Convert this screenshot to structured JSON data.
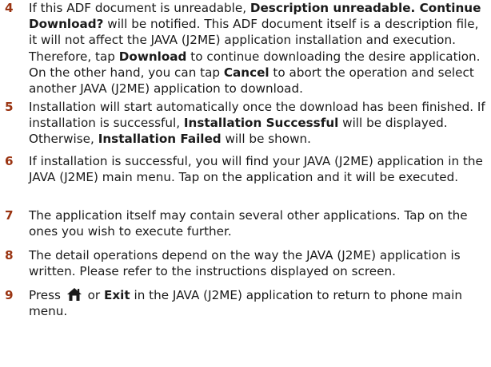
{
  "steps": [
    {
      "number": "4",
      "p1": "If this ADF document is unreadable, ",
      "b1": "Description unreadable. Continue Download?",
      "p2": " will be notified. This ADF document itself is a description file, it will not affect the JAVA (J2ME) application installation and execution. Therefore, tap ",
      "b2": "Download",
      "p3": " to continue downloading the desire application. On the other hand, you can tap ",
      "b3": "Cancel",
      "p4": " to abort the operation and select another JAVA (J2ME) application to download."
    },
    {
      "number": "5",
      "p1": "Installation will start automatically once the download has been finished. If installation is successful, ",
      "b1": "Installation Successful",
      "p2": " will be displayed. Otherwise, ",
      "b2": "Installation Failed",
      "p3": " will be shown."
    },
    {
      "number": "6",
      "p1": "If installation is successful, you will find your JAVA (J2ME) application in the JAVA (J2ME) main menu. Tap on the application and it will be executed."
    },
    {
      "number": "7",
      "p1": "The application itself may contain several other applications. Tap on the ones you wish to execute further."
    },
    {
      "number": "8",
      "p1": "The detail operations depend on the way the JAVA (J2ME) application is written. Please refer to the instructions displayed on screen."
    },
    {
      "number": "9",
      "p1": "Press ",
      "icon": "home-icon",
      "p2": " or ",
      "b1": "Exit",
      "p3": " in the JAVA (J2ME) application to return to phone main menu."
    }
  ],
  "colors": {
    "step_number": "#9a3412",
    "text": "#1a1a1a",
    "icon": "#1a1a1a"
  }
}
